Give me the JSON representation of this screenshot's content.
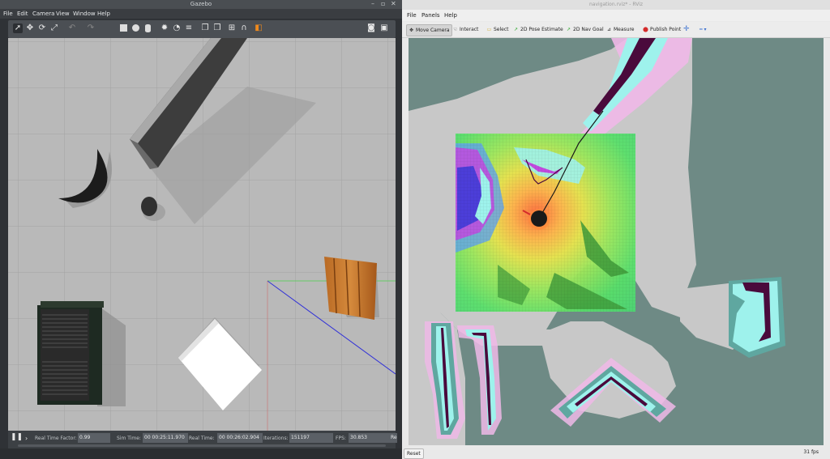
{
  "gazebo": {
    "title": "Gazebo",
    "window_buttons": [
      "–",
      "▫",
      "✕"
    ],
    "menu": [
      "File",
      "Edit",
      "Camera",
      "View",
      "Window",
      "Help"
    ],
    "status": {
      "rtf_label": "Real Time Factor:",
      "rtf_value": "0.99",
      "sim_label": "Sim Time:",
      "sim_value": "00 00:25:11.970",
      "real_label": "Real Time:",
      "real_value": "00 00:26:02.904",
      "iter_label": "Iterations:",
      "iter_value": "151197",
      "fps_label": "FPS:",
      "fps_value": "30.853",
      "reset_label": "Re"
    }
  },
  "rviz": {
    "title": "navigation.rviz* - RViz",
    "menu": [
      "File",
      "Panels",
      "Help"
    ],
    "tools": [
      {
        "label": "Move Camera",
        "icon": "move-camera-icon"
      },
      {
        "label": "Interact",
        "icon": "interact-icon"
      },
      {
        "label": "Select",
        "icon": "select-icon"
      },
      {
        "label": "2D Pose Estimate",
        "icon": "pose-estimate-icon"
      },
      {
        "label": "2D Nav Goal",
        "icon": "nav-goal-icon"
      },
      {
        "label": "Measure",
        "icon": "measure-icon"
      },
      {
        "label": "Publish Point",
        "icon": "publish-point-icon"
      }
    ],
    "reset_label": "Reset",
    "fps": "31 fps"
  },
  "colors": {
    "map_unknown": "#6e8a85",
    "map_free": "#c8c8c8",
    "costmap_inflation_pink": "#f0b8e8",
    "costmap_cyan": "#9ef2ec",
    "costmap_wall": "#4a0a3c",
    "gazebo_ground": "#b9b9b9"
  }
}
